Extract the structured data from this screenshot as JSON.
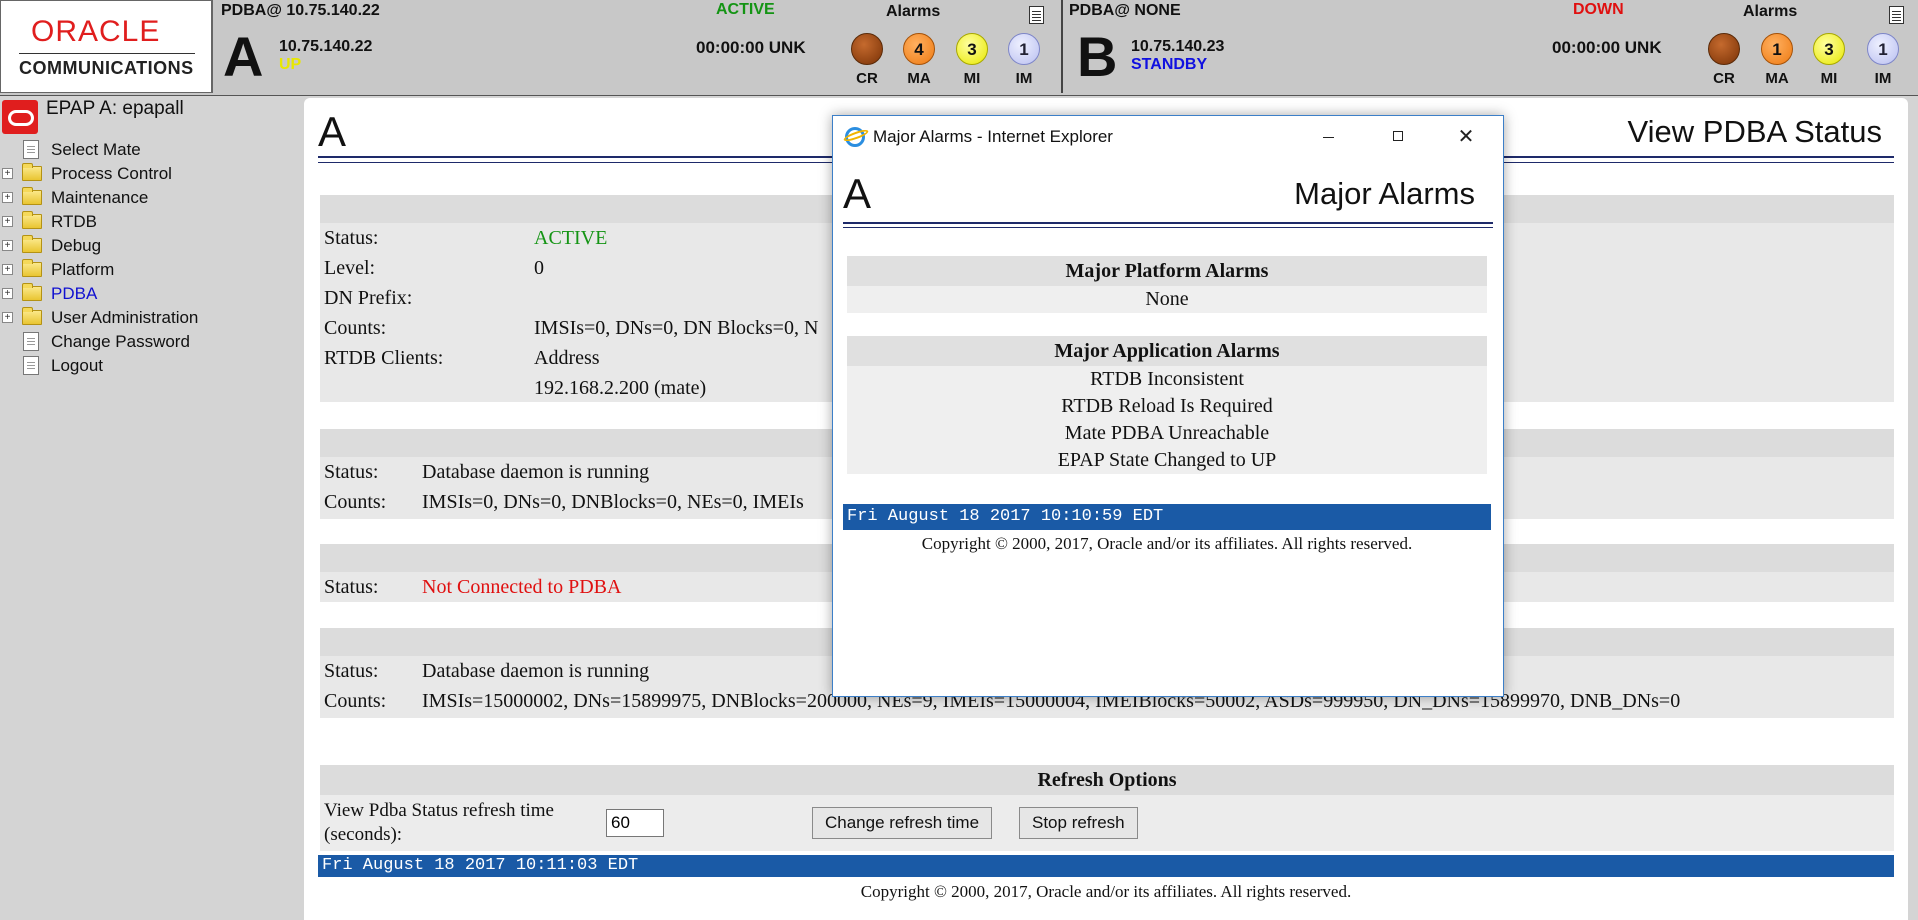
{
  "header": {
    "logo": {
      "brand": "ORACLE",
      "sub": "COMMUNICATIONS"
    },
    "system_a": {
      "title": "PDBA@ 10.75.140.22",
      "state": "ACTIVE",
      "state_color": "#149414",
      "letter": "A",
      "ip": "10.75.140.22",
      "sub_status": "UP",
      "sub_color": "#e8e800",
      "time": "00:00:00 UNK",
      "alarms_label": "Alarms",
      "alarms": [
        {
          "label": "CR",
          "count": ""
        },
        {
          "label": "MA",
          "count": "4"
        },
        {
          "label": "MI",
          "count": "3"
        },
        {
          "label": "IM",
          "count": "1"
        }
      ]
    },
    "system_b": {
      "title": "PDBA@ NONE",
      "state": "DOWN",
      "state_color": "#e01010",
      "letter": "B",
      "ip": "10.75.140.23",
      "sub_status": "STANDBY",
      "sub_color": "#1010e0",
      "time": "00:00:00 UNK",
      "alarms_label": "Alarms",
      "alarms": [
        {
          "label": "CR",
          "count": ""
        },
        {
          "label": "MA",
          "count": "1"
        },
        {
          "label": "MI",
          "count": "3"
        },
        {
          "label": "IM",
          "count": "1"
        }
      ]
    }
  },
  "sidebar": {
    "title": "EPAP A: epapall",
    "items": [
      {
        "label": "Select Mate",
        "type": "doc"
      },
      {
        "label": "Process Control",
        "type": "folder"
      },
      {
        "label": "Maintenance",
        "type": "folder"
      },
      {
        "label": "RTDB",
        "type": "folder"
      },
      {
        "label": "Debug",
        "type": "folder"
      },
      {
        "label": "Platform",
        "type": "folder"
      },
      {
        "label": "PDBA",
        "type": "folder",
        "active": true
      },
      {
        "label": "User Administration",
        "type": "folder"
      },
      {
        "label": "Change Password",
        "type": "doc"
      },
      {
        "label": "Logout",
        "type": "doc"
      }
    ]
  },
  "main": {
    "letter": "A",
    "title": "View PDBA Status",
    "panel1": {
      "status_label": "Status:",
      "status_value": "ACTIVE",
      "level_label": "Level:",
      "level_value": "0",
      "dnprefix_label": "DN Prefix:",
      "dnprefix_value": "",
      "counts_label": "Counts:",
      "counts_value": "IMSIs=0, DNs=0, DN Blocks=0, N",
      "clients_label": "RTDB Clients:",
      "clients_header": "Address",
      "clients_value": "192.168.2.200 (mate)"
    },
    "panel2": {
      "status_label": "Status:",
      "status_value": "Database daemon is running",
      "counts_label": "Counts:",
      "counts_value": "IMSIs=0, DNs=0, DNBlocks=0, NEs=0, IMEIs"
    },
    "panel3": {
      "status_label": "Status:",
      "status_value": "Not Connected to PDBA"
    },
    "panel4": {
      "status_label": "Status:",
      "status_value": "Database daemon is running",
      "counts_label": "Counts:",
      "counts_value": "IMSIs=15000002, DNs=15899975, DNBlocks=200000, NEs=9, IMEIs=15000004, IMEIBlocks=50002, ASDs=999950, DN_DNs=15899970, DNB_DNs=0"
    },
    "refresh": {
      "header": "Refresh Options",
      "label": "View Pdba Status refresh time (seconds):",
      "value": "60",
      "change_button": "Change refresh time",
      "stop_button": "Stop refresh"
    },
    "datetime": "Fri August 18 2017 10:11:03 EDT",
    "copyright": "Copyright © 2000, 2017, Oracle and/or its affiliates. All rights reserved."
  },
  "popup": {
    "window_title": "Major Alarms - Internet Explorer",
    "letter": "A",
    "heading": "Major Alarms",
    "platform_header": "Major Platform Alarms",
    "platform_items": [
      "None"
    ],
    "application_header": "Major Application Alarms",
    "application_items": [
      "RTDB Inconsistent",
      "RTDB Reload Is Required",
      "Mate PDBA Unreachable",
      "EPAP State Changed to UP"
    ],
    "datetime": "Fri August 18 2017 10:10:59 EDT",
    "copyright": "Copyright © 2000, 2017, Oracle and/or its affiliates. All rights reserved."
  }
}
